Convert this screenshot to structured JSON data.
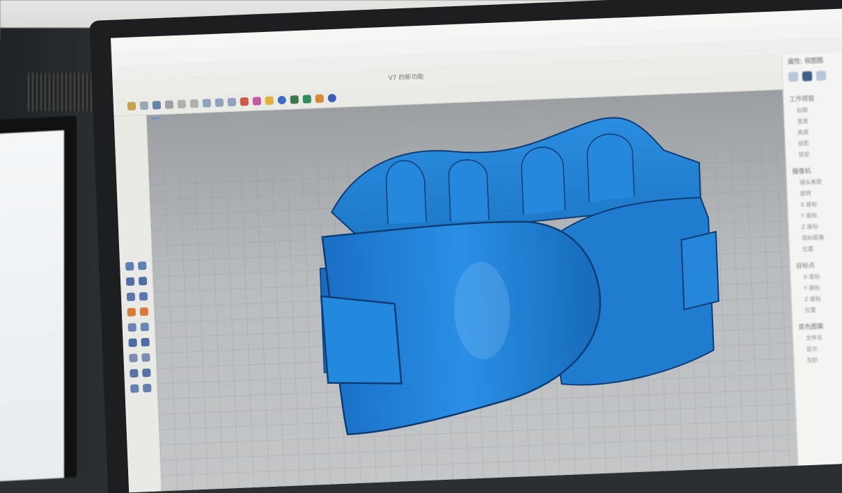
{
  "app": {
    "title_fragments": [
      "",
      ""
    ],
    "menus": [
      "",
      "",
      "",
      "",
      "",
      "",
      "",
      "",
      "",
      "",
      "",
      "",
      ""
    ],
    "command_prompt": ""
  },
  "tabs": [
    {
      "label": ""
    },
    {
      "label": ""
    },
    {
      "label": ""
    },
    {
      "label": ""
    },
    {
      "label": ""
    },
    {
      "label": ""
    },
    {
      "label": ""
    },
    {
      "label": "V7 的新功能"
    }
  ],
  "viewport": {
    "label": "",
    "model_color": "#1e7fd6",
    "background": "#b5b8bb"
  },
  "properties_panel": {
    "title": "属性: 视图图",
    "section_viewport": "工作视窗",
    "viewport_items": [
      "标题",
      "宽度",
      "高度",
      "投影",
      "锁定"
    ],
    "section_camera": "摄像机",
    "camera_items": [
      "镜头焦距",
      "旋转",
      "X 座标",
      "Y 座标",
      "Z 座标",
      "目标距离",
      "位置"
    ],
    "section_target": "目标点",
    "target_items": [
      "X 座标",
      "Y 座标",
      "Z 座标",
      "位置"
    ],
    "section_wallpaper": "底色图案",
    "wallpaper_items": [
      "文件名",
      "显示",
      "灰阶"
    ]
  },
  "icons": {
    "vertical_tools": [
      "point-icon",
      "line-icon",
      "polyline-icon",
      "curve-icon",
      "circle-icon",
      "arc-icon",
      "rectangle-icon",
      "polygon-icon",
      "surface-icon",
      "extrude-icon",
      "solid-icon",
      "mesh-icon",
      "transform-icon",
      "array-icon",
      "boolean-icon",
      "fillet-icon",
      "analyze-icon",
      "dimension-icon"
    ],
    "toolbar_icons": [
      "new-icon",
      "open-icon",
      "save-icon",
      "print-icon",
      "undo-icon",
      "redo-icon",
      "pan-icon",
      "rotate-icon",
      "zoom-icon",
      "render-icon",
      "material-icon",
      "light-icon",
      "sphere-icon",
      "settings-icon"
    ]
  }
}
